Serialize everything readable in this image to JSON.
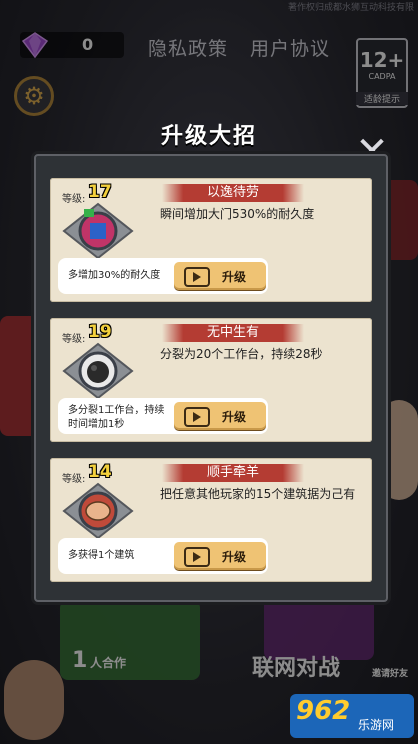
{
  "top": {
    "copyright": "著作权归成都水狮互动科技有限",
    "gem_count": "0",
    "privacy_label": "隐私政策",
    "agreement_label": "用户协议",
    "age_rating": "12+",
    "age_org": "CADPA",
    "age_tip": "适龄提示"
  },
  "dialog": {
    "title": "升级大招",
    "level_prefix": "等级:",
    "upgrade_label": "升级",
    "cards": [
      {
        "level": "17",
        "name": "以逸待劳",
        "desc": "瞬间增加大门530%的耐久度",
        "bonus": "多增加30%的耐久度"
      },
      {
        "level": "19",
        "name": "无中生有",
        "desc": "分裂为20个工作台，持续28秒",
        "bonus": "多分裂1工作台，持续时间增加1秒"
      },
      {
        "level": "14",
        "name": "顺手牵羊",
        "desc": "把任意其他玩家的15个建筑据为己有",
        "bonus": "多获得1个建筑"
      }
    ]
  },
  "background": {
    "coop_count": "1",
    "coop_label": "人合作",
    "online_label": "联网对战",
    "tag_label": "邀请好友"
  },
  "watermark": {
    "brand": "962",
    "sub": "乐游网"
  },
  "colors": {
    "card_bg": "#ece3cf",
    "title_ribbon": "#b43c33",
    "button": "#efc374",
    "level_number": "#f3d03c"
  }
}
